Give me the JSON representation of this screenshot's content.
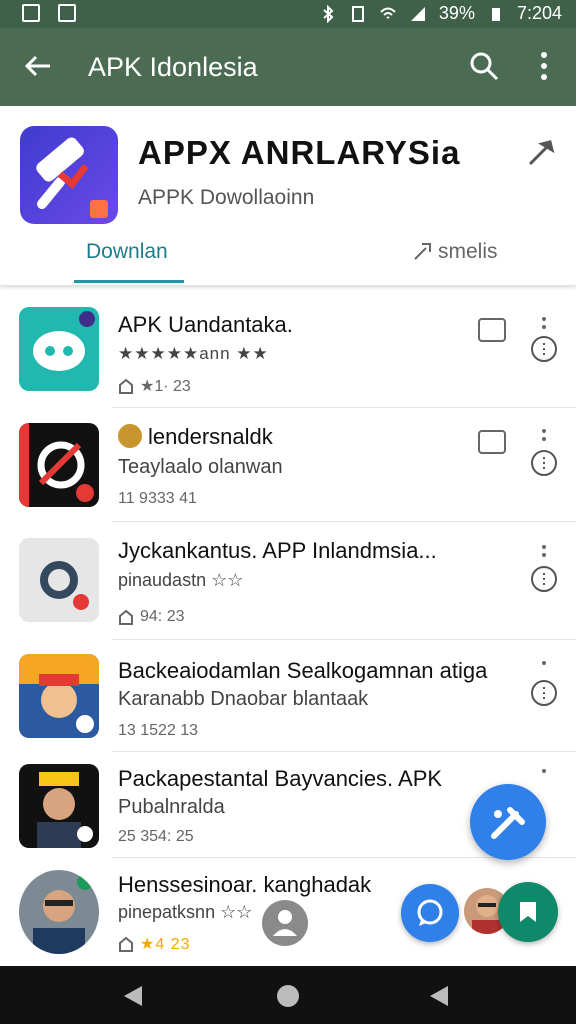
{
  "status": {
    "battery": "39%",
    "time": "7:204"
  },
  "appbar": {
    "title": "APK Idonlesia"
  },
  "header": {
    "app_name": "APPX  ANRLARYSia",
    "subtitle": "APPK Dowollaoinn",
    "tab_active": "Downlan",
    "tab_other": "smelis"
  },
  "items": [
    {
      "title": "APK Uandantaka.",
      "sub": "★★★★★ann ★★",
      "meta": "★1·  23"
    },
    {
      "title": "lendersnaldk",
      "sub": "Teaylaalo olanwan",
      "meta": "11 9333 41"
    },
    {
      "title": "Jyckankantus. APP  Inlandmsia...",
      "sub": "pinaudastn ☆☆",
      "meta": "94:  23"
    },
    {
      "title": "Backeaiodamlan Sealkogamnan atiga",
      "sub": "Karanabb Dnaobar  blantaak",
      "meta": "13 1522 13"
    },
    {
      "title": "Packapestantal Bayvancies. APK",
      "sub": "Pubalnralda",
      "meta": "25 354:  25"
    },
    {
      "title": "Henssesinoar. kanghadak",
      "sub": "pinepatksnn ☆☆",
      "meta": "★4  23"
    }
  ],
  "colors": {
    "appbar": "#4b6b53",
    "accent": "#2196a5",
    "fab": "#2f80e8"
  },
  "icons": [
    "back-arrow-icon",
    "search-icon",
    "more-vert-icon",
    "close-icon",
    "share-icon",
    "download-icon",
    "chat-icon",
    "person-icon",
    "nav-back-icon",
    "nav-home-icon",
    "nav-recent-icon"
  ]
}
